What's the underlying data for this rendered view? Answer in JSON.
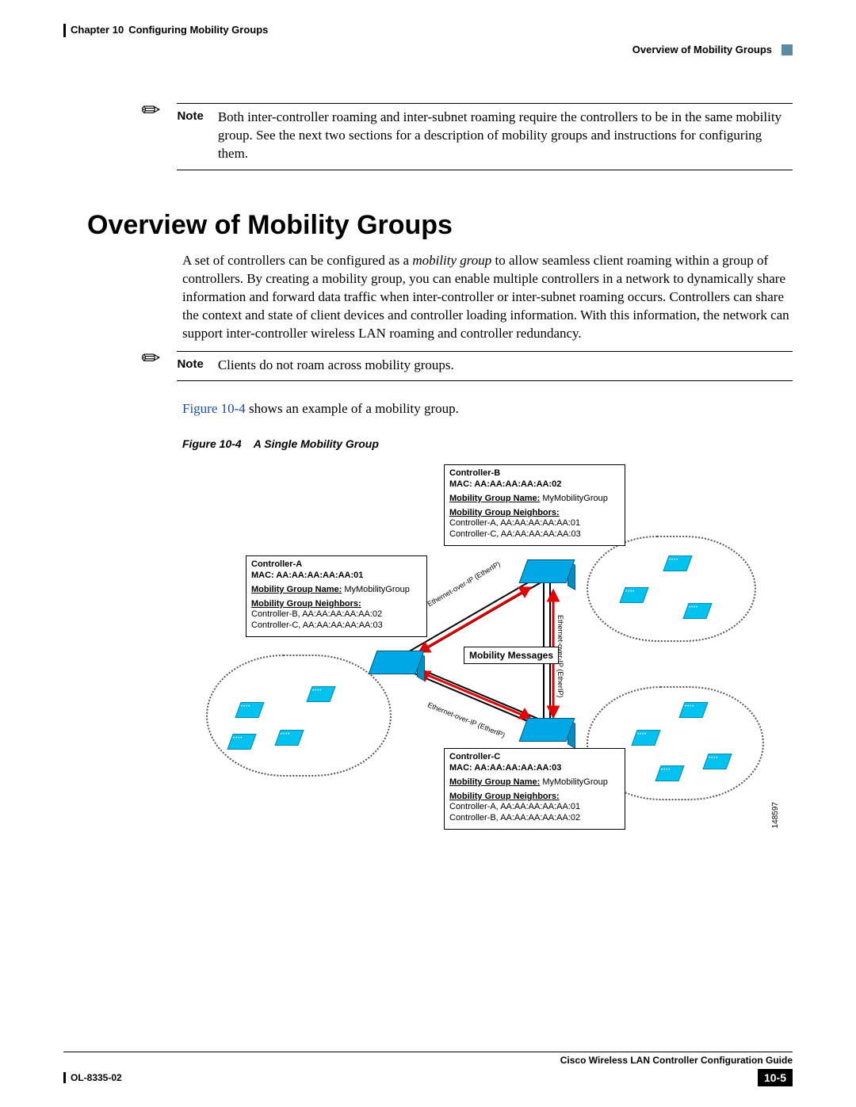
{
  "header": {
    "chapter_prefix": "Chapter 10",
    "chapter_title": "Configuring Mobility Groups",
    "running_section": "Overview of Mobility Groups"
  },
  "note1": {
    "label": "Note",
    "text": "Both inter-controller roaming and inter-subnet roaming require the controllers to be in the same mobility group. See the next two sections for a description of mobility groups and instructions for configuring them."
  },
  "heading": "Overview of Mobility Groups",
  "intro_para": "A set of controllers can be configured as a mobility group to allow seamless client roaming within a group of controllers. By creating a mobility group, you can enable multiple controllers in a network to dynamically share information and forward data traffic when inter-controller or inter-subnet roaming occurs. Controllers can share the context and state of client devices and controller loading information. With this information, the network can support inter-controller wireless LAN roaming and controller redundancy.",
  "intro_italic_phrase": "mobility group",
  "note2": {
    "label": "Note",
    "text": "Clients do not roam across mobility groups."
  },
  "figref_sentence_prefix": "Figure 10-4",
  "figref_sentence_rest": " shows an example of a mobility group.",
  "figure_caption_label": "Figure 10-4",
  "figure_caption_title": "A Single Mobility Group",
  "figure": {
    "messages_label": "Mobility Messages",
    "link_label": "Ethernet-over-IP (EtherIP)",
    "side_code": "148597",
    "controllers": {
      "A": {
        "title": "Controller-A",
        "mac": "MAC: AA:AA:AA:AA:AA:01",
        "group_label": "Mobility Group Name:",
        "group_value": "MyMobilityGroup",
        "neighbors_label": "Mobility Group Neighbors:",
        "neighbor1": "Controller-B, AA:AA:AA:AA:AA:02",
        "neighbor2": "Controller-C, AA:AA:AA:AA:AA:03"
      },
      "B": {
        "title": "Controller-B",
        "mac": "MAC: AA:AA:AA:AA:AA:02",
        "group_label": "Mobility Group Name:",
        "group_value": "MyMobilityGroup",
        "neighbors_label": "Mobility Group Neighbors:",
        "neighbor1": "Controller-A, AA:AA:AA:AA:AA:01",
        "neighbor2": "Controller-C, AA:AA:AA:AA:AA:03"
      },
      "C": {
        "title": "Controller-C",
        "mac": "MAC: AA:AA:AA:AA:AA:03",
        "group_label": "Mobility Group Name:",
        "group_value": "MyMobilityGroup",
        "neighbors_label": "Mobility Group Neighbors:",
        "neighbor1": "Controller-A, AA:AA:AA:AA:AA:01",
        "neighbor2": "Controller-B, AA:AA:AA:AA:AA:02"
      }
    }
  },
  "footer": {
    "book_title": "Cisco Wireless LAN Controller Configuration Guide",
    "doc_id": "OL-8335-02",
    "page_number": "10-5"
  }
}
